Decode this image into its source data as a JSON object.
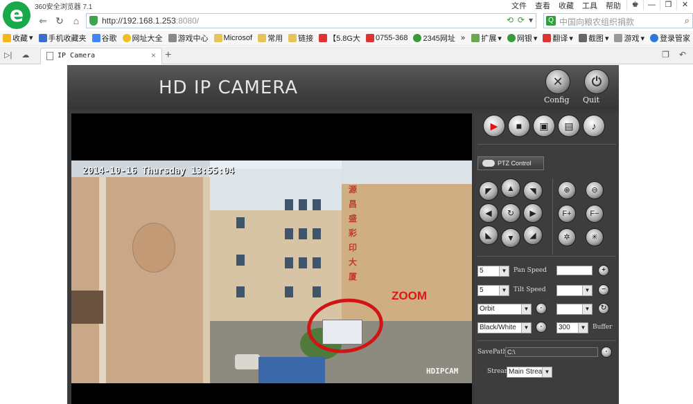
{
  "browser": {
    "logo_text": "e",
    "app_title": "360安全浏览器 7.1",
    "menu": [
      "文件",
      "查看",
      "收藏",
      "工具",
      "帮助"
    ],
    "window_buttons": [
      "♚",
      "—",
      "❐",
      "✕"
    ],
    "url_host": "http://192.168.1.253",
    "url_port": ":8080/",
    "search_placeholder": "中国向粮农组织捐款",
    "bookmarks_left": [
      "收藏",
      "手机收藏夹",
      "谷歌",
      "网址大全",
      "游戏中心",
      "Microsof",
      "常用",
      "链接",
      "【5.8G大",
      "0755-368",
      "2345网址"
    ],
    "bookmarks_right": [
      "扩展",
      "网银",
      "翻译",
      "截图",
      "游戏",
      "登录管家"
    ],
    "tab_title": "IP Camera"
  },
  "camera": {
    "title": "HD IP CAMERA",
    "config_label": "Config",
    "quit_label": "Quit",
    "timestamp": "2014-10-16 Thursday 13:55:04",
    "watermark": "HDIPCAM",
    "zoom_annotation": "ZOOM",
    "sign_text": [
      "源",
      "昌",
      "盛",
      "彩",
      "印",
      "大",
      "厦"
    ],
    "ptz_label": "PTZ Control",
    "pan_speed_value": "5",
    "pan_speed_label": "Pan Speed",
    "tilt_speed_value": "5",
    "tilt_speed_label": "Tilt Speed",
    "mode_value": "Orbit",
    "color_value": "Black/White",
    "buffer_value": "300",
    "buffer_label": "Buffer",
    "savepath_label": "SavePath",
    "savepath_value": "C:\\",
    "stream_label": "Stream",
    "stream_value": "Main Strea"
  }
}
